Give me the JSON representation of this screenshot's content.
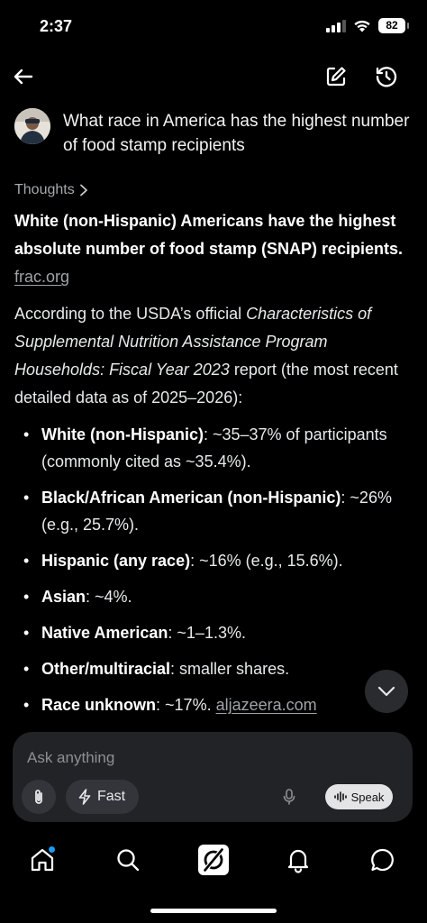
{
  "status_bar": {
    "time": "2:37",
    "battery": "82"
  },
  "header": {
    "back_icon": "arrow-left-icon",
    "edit_icon": "compose-icon",
    "history_icon": "history-icon"
  },
  "query": {
    "text": "What race in America has the highest number of food stamp recipients"
  },
  "answer": {
    "thoughts_label": "Thoughts",
    "summary_bold": "White (non-Hispanic) Americans have the highest absolute number of food stamp (SNAP) recipients.",
    "summary_link": "frac.org",
    "intro_1": "According to the USDA’s official ",
    "intro_italic": "Characteristics of Supplemental Nutrition Assistance Program Households: Fiscal Year 2023",
    "intro_2": " report (the most recent detailed data as of 2025–2026):",
    "bullets": [
      {
        "label": "White (non-Hispanic)",
        "text": ": ~35–37% of participants (commonly cited as ~35.4%)."
      },
      {
        "label": "Black/African American (non-Hispanic)",
        "text": ": ~26% (e.g., 25.7%)."
      },
      {
        "label": "Hispanic (any race)",
        "text": ": ~16% (e.g., 15.6%)."
      },
      {
        "label": "Asian",
        "text": ": ~4%."
      },
      {
        "label": "Native American",
        "text": ": ~1–1.3%."
      },
      {
        "label": "Other/multiracial",
        "text": ": smaller shares."
      },
      {
        "label": "Race unknown",
        "text": ": ~17%. ",
        "link": "aljazeera.com"
      }
    ]
  },
  "composer": {
    "placeholder": "Ask anything",
    "fast_label": "Fast",
    "speak_label": "Speak"
  },
  "nav": {
    "items": [
      "home-icon",
      "search-icon",
      "grok-icon",
      "notifications-icon",
      "messages-icon"
    ]
  },
  "colors": {
    "background": "#000000",
    "accent": "#1d9bf0",
    "composer_bg": "#222326"
  }
}
